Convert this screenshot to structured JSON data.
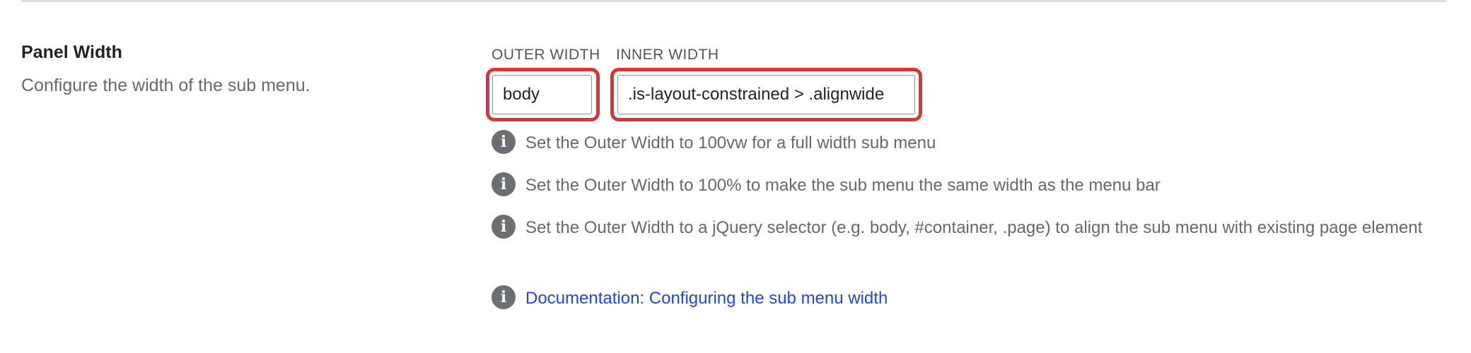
{
  "setting": {
    "label": "Panel Width",
    "description": "Configure the width of the sub menu."
  },
  "fields": {
    "outer": {
      "header": "OUTER WIDTH",
      "value": "body"
    },
    "inner": {
      "header": "INNER WIDTH",
      "value": ".is-layout-constrained > .alignwide"
    }
  },
  "highlight_color": "#d63638",
  "info": {
    "icon": "info-icon",
    "items": [
      "Set the Outer Width to 100vw for a full width sub menu",
      "Set the Outer Width to 100% to make the sub menu the same width as the menu bar",
      "Set the Outer Width to a jQuery selector (e.g. body, #container, .page) to align the sub menu with existing page element"
    ],
    "doc_link": "Documentation: Configuring the sub menu width"
  },
  "colors": {
    "link": "#2145e6",
    "muted_text": "#646970",
    "heading_text": "#1d2327"
  }
}
